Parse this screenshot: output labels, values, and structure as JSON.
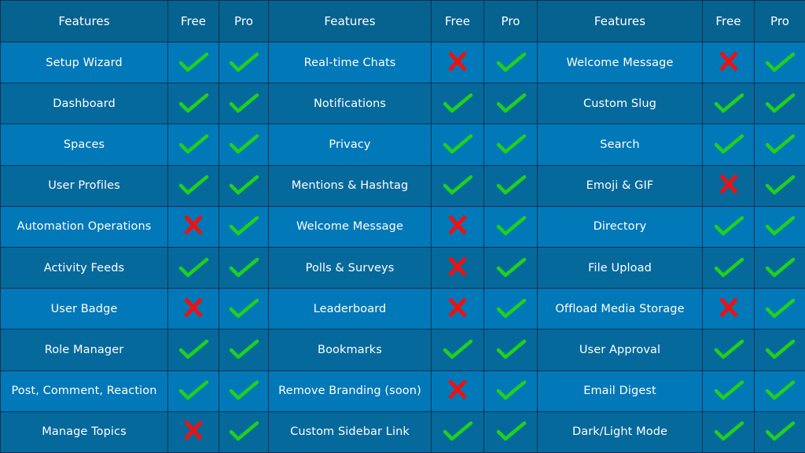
{
  "colors": {
    "check": "#1ed11e",
    "cross": "#ee1111",
    "header_bg": "#06628f",
    "row_light": "#0178b8",
    "row_dark": "#06699c"
  },
  "headers": {
    "groups": [
      {
        "features": "Features",
        "free": "Free",
        "pro": "Pro"
      },
      {
        "features": "Features",
        "free": "Free",
        "pro": "Pro"
      },
      {
        "features": "Features",
        "free": "Free",
        "pro": "Pro"
      }
    ]
  },
  "rows": [
    [
      {
        "name": "Setup Wizard",
        "free": true,
        "pro": true
      },
      {
        "name": "Real-time Chats",
        "free": false,
        "pro": true
      },
      {
        "name": "Welcome Message",
        "free": false,
        "pro": true
      }
    ],
    [
      {
        "name": "Dashboard",
        "free": true,
        "pro": true
      },
      {
        "name": "Notifications",
        "free": true,
        "pro": true
      },
      {
        "name": "Custom Slug",
        "free": true,
        "pro": true
      }
    ],
    [
      {
        "name": "Spaces",
        "free": true,
        "pro": true
      },
      {
        "name": "Privacy",
        "free": true,
        "pro": true
      },
      {
        "name": "Search",
        "free": true,
        "pro": true
      }
    ],
    [
      {
        "name": "User Profiles",
        "free": true,
        "pro": true
      },
      {
        "name": "Mentions & Hashtag",
        "free": true,
        "pro": true
      },
      {
        "name": "Emoji & GIF",
        "free": false,
        "pro": true
      }
    ],
    [
      {
        "name": "Automation Operations",
        "free": false,
        "pro": true
      },
      {
        "name": "Welcome Message",
        "free": false,
        "pro": true
      },
      {
        "name": "Directory",
        "free": true,
        "pro": true
      }
    ],
    [
      {
        "name": "Activity Feeds",
        "free": true,
        "pro": true
      },
      {
        "name": "Polls & Surveys",
        "free": false,
        "pro": true
      },
      {
        "name": "File Upload",
        "free": true,
        "pro": true
      }
    ],
    [
      {
        "name": "User Badge",
        "free": false,
        "pro": true
      },
      {
        "name": "Leaderboard",
        "free": false,
        "pro": true
      },
      {
        "name": "Offload Media Storage",
        "free": false,
        "pro": true
      }
    ],
    [
      {
        "name": "Role Manager",
        "free": true,
        "pro": true
      },
      {
        "name": "Bookmarks",
        "free": true,
        "pro": true
      },
      {
        "name": "User Approval",
        "free": true,
        "pro": true
      }
    ],
    [
      {
        "name": "Post, Comment, Reaction",
        "free": true,
        "pro": true
      },
      {
        "name": "Remove Branding (soon)",
        "free": false,
        "pro": true
      },
      {
        "name": "Email Digest",
        "free": true,
        "pro": true
      }
    ],
    [
      {
        "name": "Manage Topics",
        "free": false,
        "pro": true
      },
      {
        "name": "Custom Sidebar Link",
        "free": true,
        "pro": true
      },
      {
        "name": "Dark/Light Mode",
        "free": true,
        "pro": true
      }
    ]
  ]
}
